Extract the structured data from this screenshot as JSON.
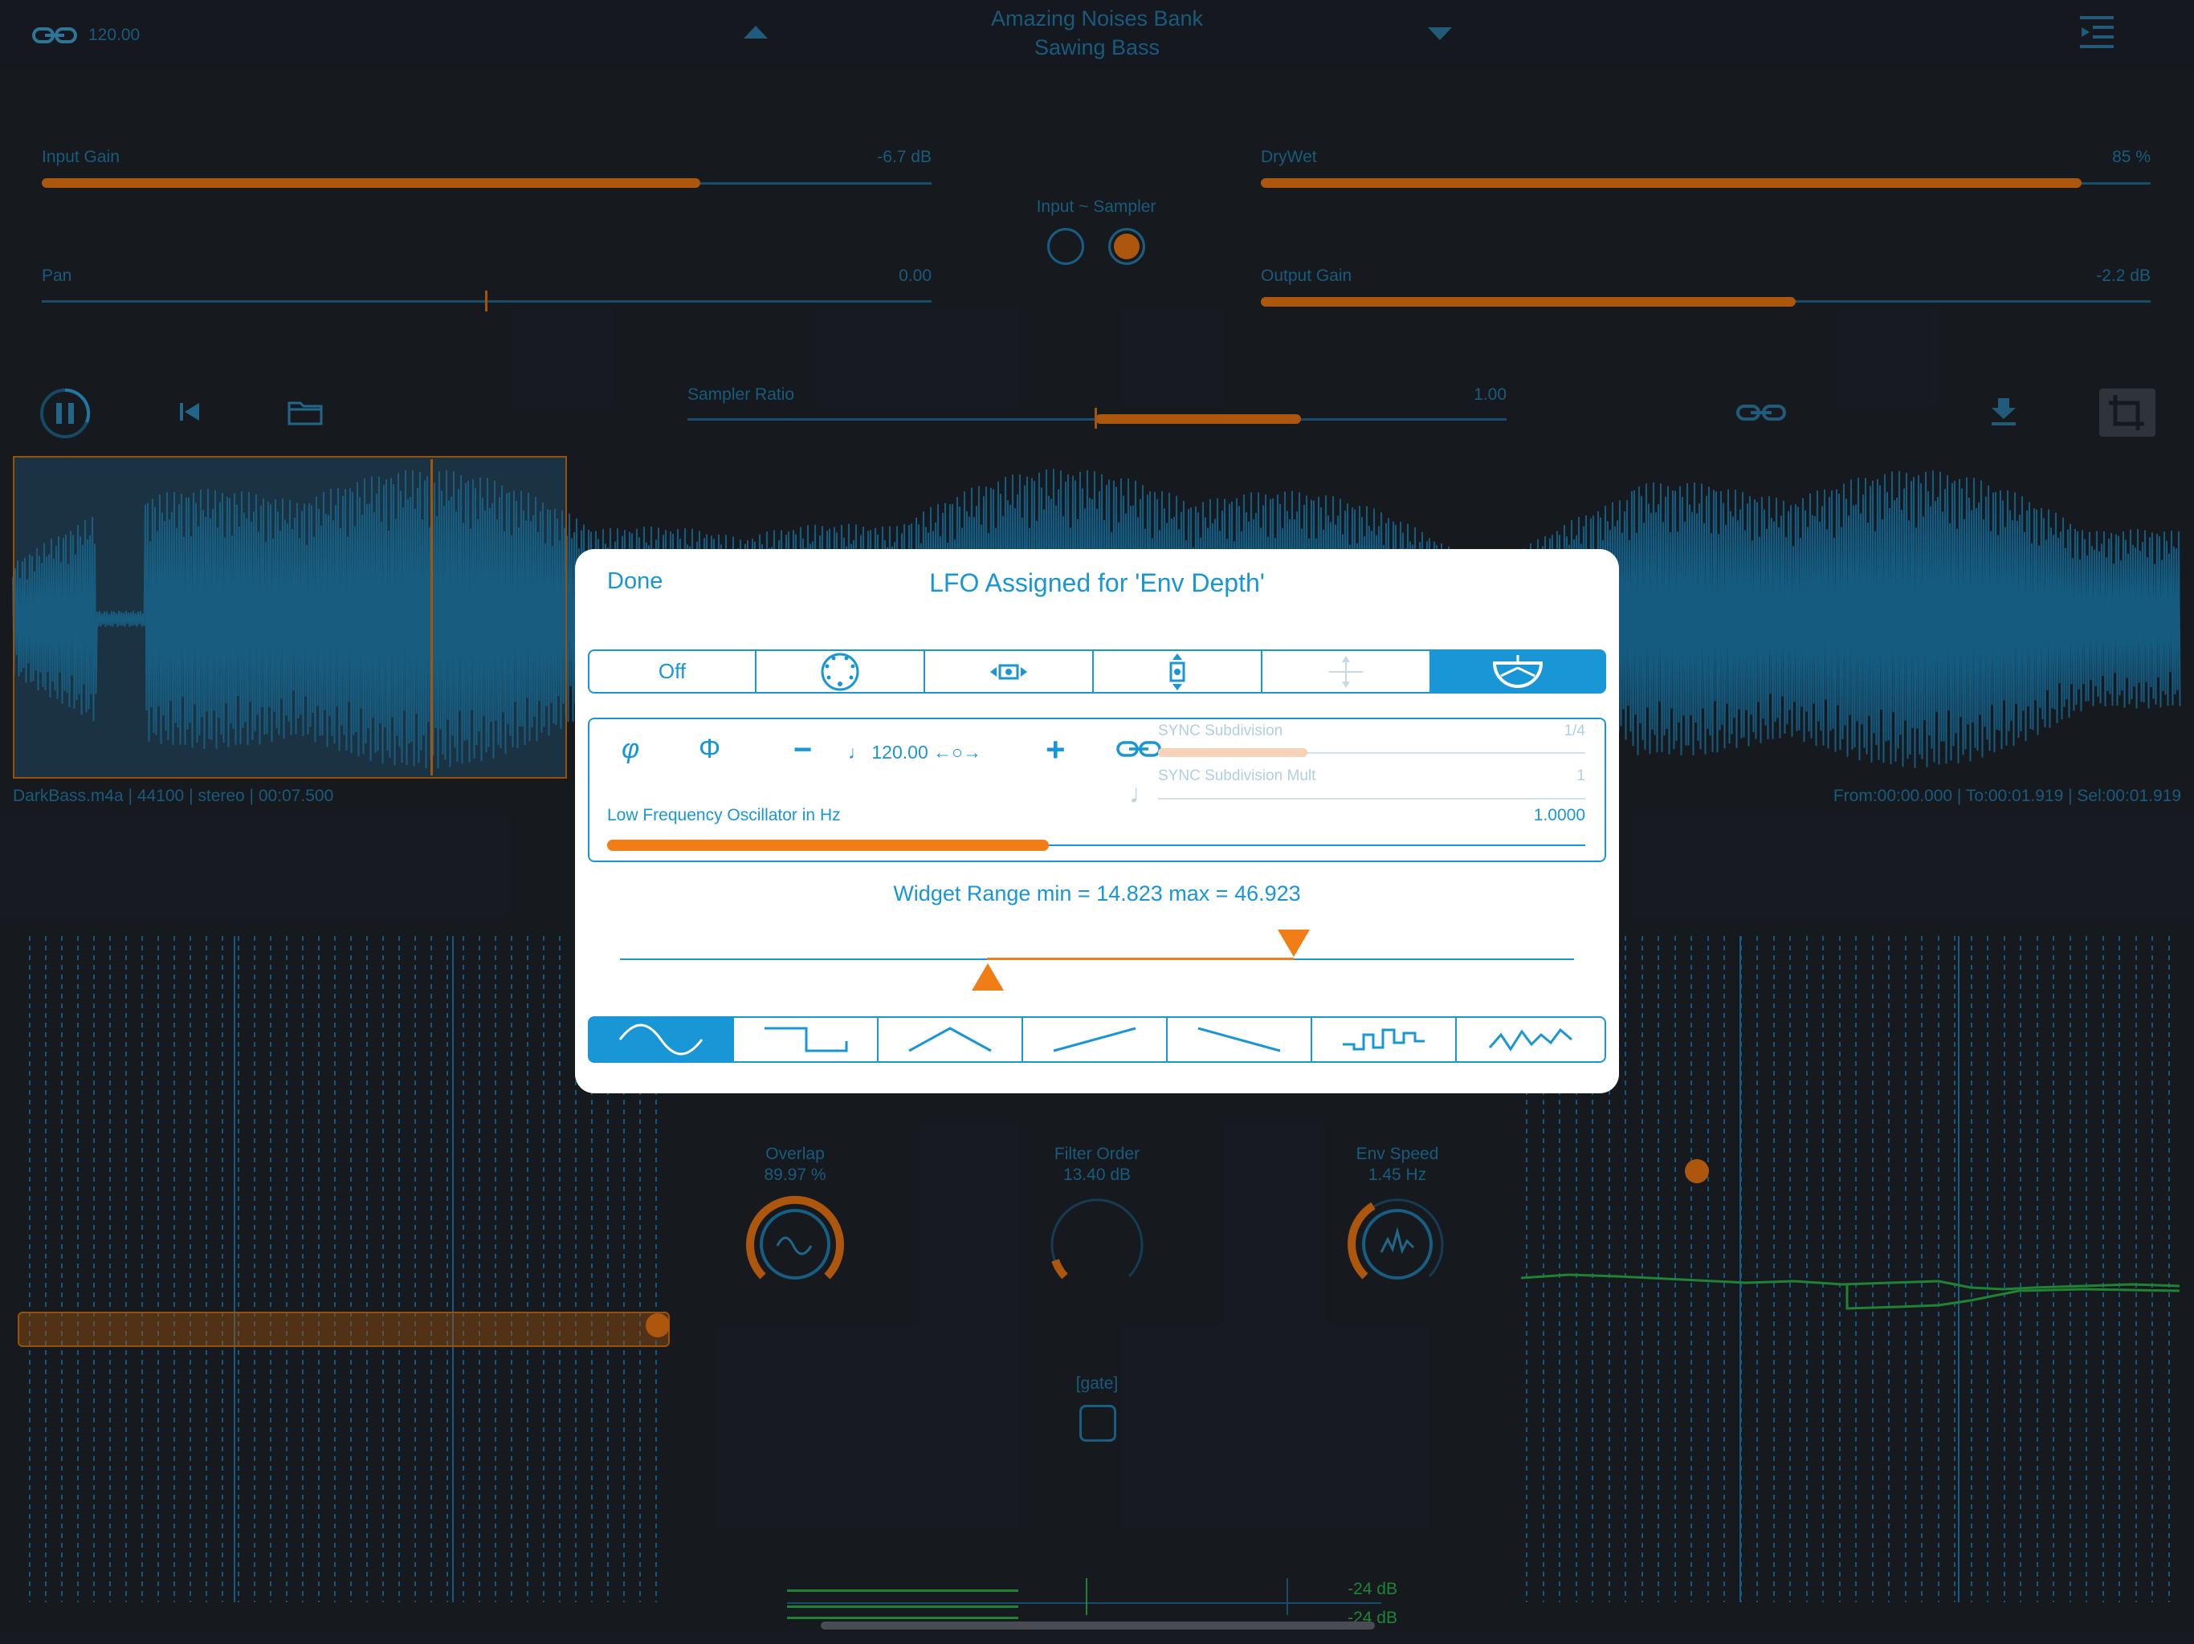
{
  "topbar": {
    "tempo": "120.00",
    "bank": "Amazing Noises Bank",
    "preset": "Sawing Bass"
  },
  "params": {
    "input_gain": {
      "label": "Input Gain",
      "value": "-6.7 dB",
      "level": 0.74
    },
    "pan": {
      "label": "Pan",
      "value": "0.00",
      "level": 0.5
    },
    "drywet": {
      "label": "DryWet",
      "value": "85 %",
      "level": 0.92
    },
    "output_gain": {
      "label": "Output Gain",
      "value": "-2.2 dB",
      "level": 0.6
    },
    "input_sampler_label": "Input ~ Sampler",
    "sampler_ratio": {
      "label": "Sampler Ratio",
      "value": "1.00"
    }
  },
  "file_info": {
    "left": "DarkBass.m4a | 44100 | stereo  | 00:07.500",
    "right": "From:00:00.000 | To:00:01.919 | Sel:00:01.919"
  },
  "knobs": {
    "overlap": {
      "label": "Overlap",
      "value": "89.97 %"
    },
    "filter_order": {
      "label": "Filter Order",
      "value": "13.40 dB"
    },
    "env_speed": {
      "label": "Env Speed",
      "value": "1.45 Hz"
    },
    "gate": "[gate]"
  },
  "meters": {
    "top": "-24 dB",
    "bottom": "-24 dB"
  },
  "modal": {
    "done": "Done",
    "title": "LFO Assigned for 'Env Depth'",
    "off": "Off",
    "phase1": "φ",
    "phase2": "Φ",
    "minus": "−",
    "tempo": "♩ 120.00 ←○→",
    "plus": "+",
    "sync_subdivision": {
      "label": "SYNC Subdivision",
      "value": "1/4"
    },
    "sync_mult": {
      "label": "SYNC Subdivision Mult",
      "value": "1"
    },
    "lfo_hz": {
      "label": "Low Frequency Oscillator in Hz",
      "value": "1.0000",
      "level": 0.44
    },
    "range_text": "Widget Range min = 14.823 max = 46.923",
    "note_glyph": "♩"
  },
  "colors": {
    "accent_blue": "#1996d6",
    "orange": "#d46a10",
    "background": "#1c2027"
  }
}
